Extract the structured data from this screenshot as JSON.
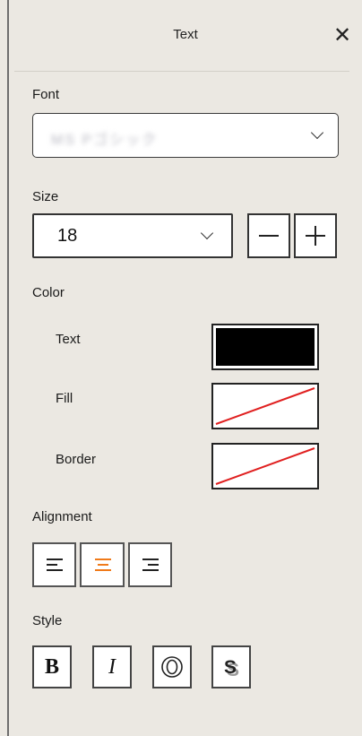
{
  "panel": {
    "title": "Text",
    "close_icon": "close-icon"
  },
  "font": {
    "label": "Font",
    "value": "MS Pゴシック"
  },
  "size": {
    "label": "Size",
    "value": "18",
    "minus_icon": "minus-icon",
    "plus_icon": "plus-icon"
  },
  "color": {
    "label": "Color",
    "items": [
      {
        "label": "Text",
        "swatch": "#000000"
      },
      {
        "label": "Fill",
        "swatch": "none"
      },
      {
        "label": "Border",
        "swatch": "none"
      }
    ],
    "none_slash_color": "#e02020"
  },
  "alignment": {
    "label": "Alignment",
    "options": [
      "align-left-icon",
      "align-center-icon",
      "align-right-icon"
    ],
    "selected": "center",
    "accent": "#f07a1a"
  },
  "style": {
    "label": "Style",
    "buttons": [
      "bold-icon",
      "italic-icon",
      "outline-icon",
      "shadow-icon"
    ]
  }
}
